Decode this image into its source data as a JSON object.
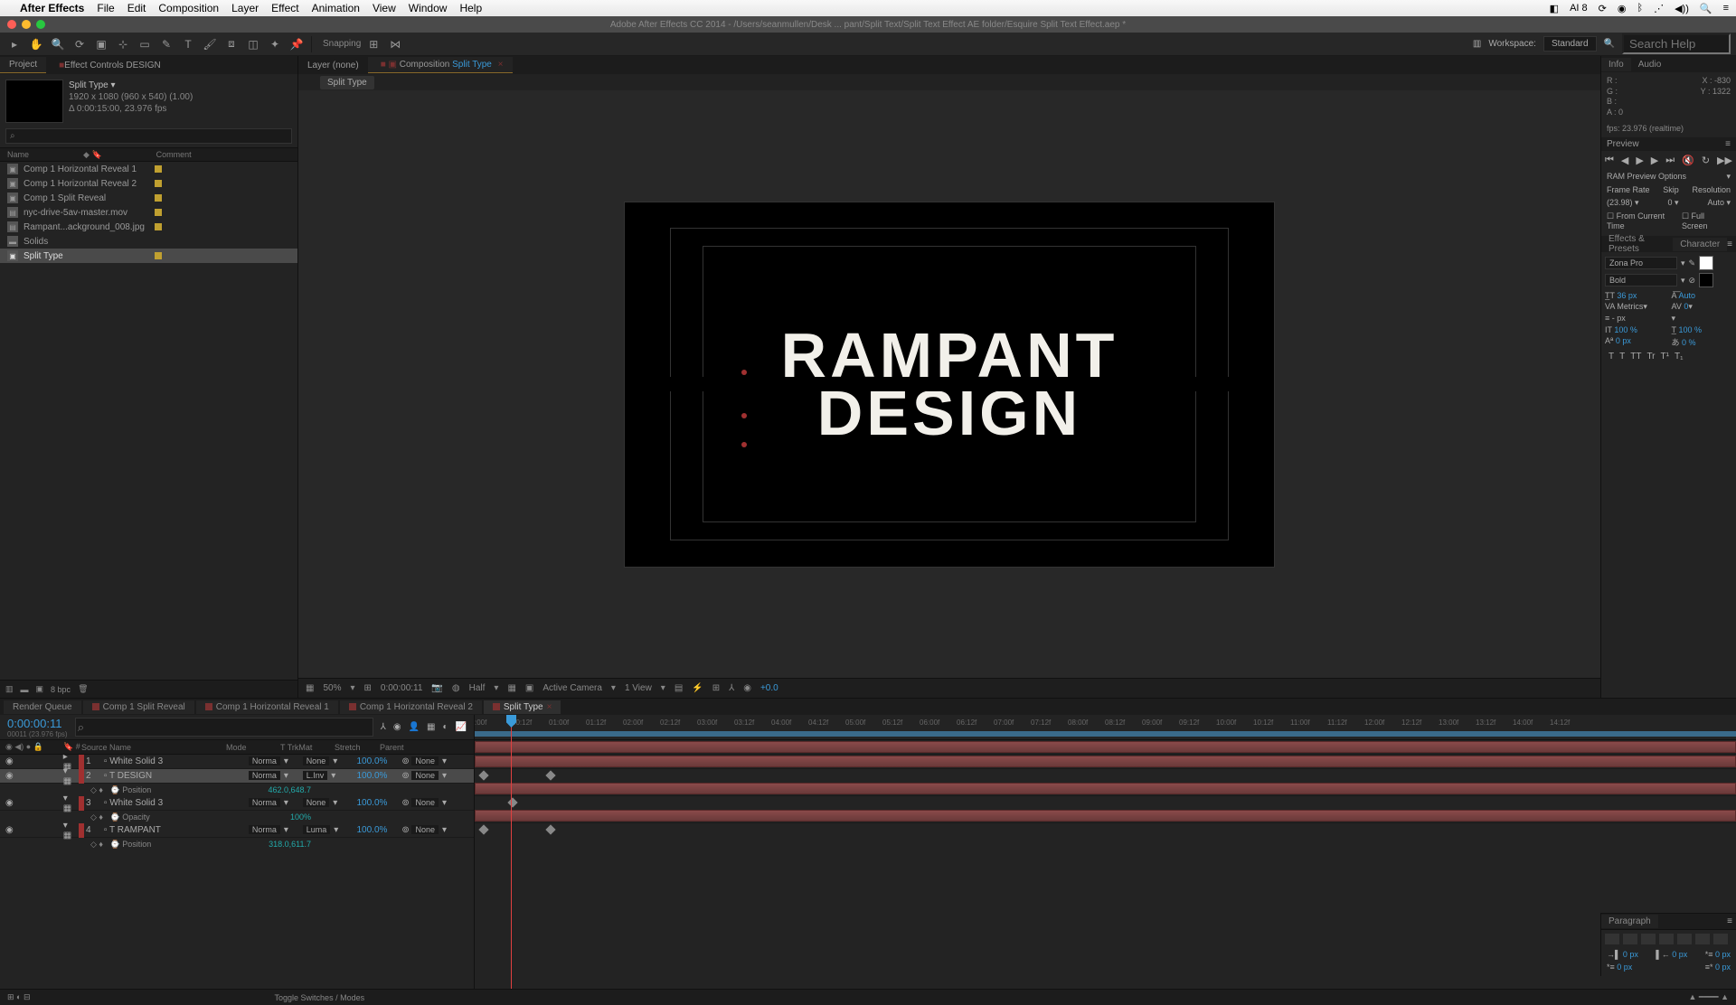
{
  "app": {
    "name": "After Effects",
    "menus": [
      "File",
      "Edit",
      "Composition",
      "Layer",
      "Effect",
      "Animation",
      "View",
      "Window",
      "Help"
    ],
    "window_title": "Adobe After Effects CC 2014 - /Users/seanmullen/Desk ... pant/Split Text/Split Text Effect AE folder/Esquire Split Text Effect.aep *"
  },
  "toolbar": {
    "snapping": "Snapping",
    "workspace_label": "Workspace:",
    "workspace_value": "Standard",
    "search_placeholder": "Search Help"
  },
  "project": {
    "tabs": {
      "project": "Project",
      "effect_controls": "Effect Controls DESIGN"
    },
    "selected_item": "Split Type ▾",
    "meta_line1": "1920 x 1080 (960 x 540) (1.00)",
    "meta_line2": "Δ 0:00:15:00, 23.976 fps",
    "header": {
      "name": "Name",
      "comment": "Comment"
    },
    "items": [
      {
        "name": "Comp 1 Horizontal Reveal 1",
        "type": "comp"
      },
      {
        "name": "Comp 1 Horizontal Reveal 2",
        "type": "comp"
      },
      {
        "name": "Comp 1 Split Reveal",
        "type": "comp"
      },
      {
        "name": "nyc-drive-5av-master.mov",
        "type": "footage"
      },
      {
        "name": "Rampant...ackground_008.jpg",
        "type": "footage"
      },
      {
        "name": "Solids",
        "type": "folder"
      },
      {
        "name": "Split Type",
        "type": "comp",
        "selected": true
      }
    ],
    "footer_bpc": "8 bpc"
  },
  "composition": {
    "layer_tab": "Layer (none)",
    "comp_tab_prefix": "Composition",
    "comp_tab_name": "Split Type",
    "flow_pill": "Split Type",
    "text_top": "RAMPANT",
    "text_bottom": "DESIGN"
  },
  "view_controls": {
    "zoom": "50%",
    "timecode": "0:00:00:11",
    "quality": "Half",
    "camera": "Active Camera",
    "views": "1 View",
    "exposure": "+0.0"
  },
  "info": {
    "tab_info": "Info",
    "tab_audio": "Audio",
    "r": "R :",
    "g": "G :",
    "b": "B :",
    "a": "A : 0",
    "x": "X : -830",
    "y": "Y : 1322",
    "fps": "fps: 23.976 (realtime)"
  },
  "preview": {
    "title": "Preview",
    "ram_options": "RAM Preview Options",
    "hdr": {
      "frame_rate": "Frame Rate",
      "skip": "Skip",
      "resolution": "Resolution"
    },
    "vals": {
      "frame_rate": "(23.98) ▾",
      "skip": "0 ▾",
      "resolution": "Auto ▾"
    },
    "from_current": "From Current Time",
    "full_screen": "Full Screen"
  },
  "effects_presets": {
    "title": "Effects & Presets"
  },
  "character": {
    "title": "Character",
    "font": "Zona Pro",
    "style": "Bold",
    "size": "36 px",
    "leading": "Auto",
    "kerning": "Metrics",
    "tracking": "0",
    "dash_px": "- px",
    "vscale": "100 %",
    "hscale": "100 %",
    "baseline": "0 px",
    "tsume": "0 %",
    "buttons": [
      "T",
      "T",
      "TT",
      "Tr",
      "T¹",
      "T₁"
    ]
  },
  "paragraph": {
    "title": "Paragraph",
    "indent": "0 px",
    "space": "0 px"
  },
  "timeline": {
    "tabs": [
      "Render Queue",
      "Comp 1 Split Reveal",
      "Comp 1 Horizontal Reveal 1",
      "Comp 1 Horizontal Reveal 2",
      "Split Type"
    ],
    "active_tab": 4,
    "timecode": "0:00:00:11",
    "timecode_sub": "00011 (23.976 fps)",
    "cols": {
      "num": "#",
      "source": "Source Name",
      "mode": "Mode",
      "trkmat": "TrkMat",
      "stretch": "Stretch",
      "parent": "Parent"
    },
    "ruler_ticks": [
      ":00f",
      "00:12f",
      "01:00f",
      "01:12f",
      "02:00f",
      "02:12f",
      "03:00f",
      "03:12f",
      "04:00f",
      "04:12f",
      "05:00f",
      "05:12f",
      "06:00f",
      "06:12f",
      "07:00f",
      "07:12f",
      "08:00f",
      "08:12f",
      "09:00f",
      "09:12f",
      "10:00f",
      "10:12f",
      "11:00f",
      "11:12f",
      "12:00f",
      "12:12f",
      "13:00f",
      "13:12f",
      "14:00f",
      "14:12f"
    ],
    "layers": [
      {
        "num": "1",
        "name": "White Solid 3",
        "mode": "Norma",
        "trkmat": "None",
        "stretch": "100.0%",
        "parent": "None"
      },
      {
        "num": "2",
        "name": "DESIGN",
        "mode": "Norma",
        "trkmat": "L.Inv",
        "stretch": "100.0%",
        "parent": "None",
        "selected": true,
        "prop": {
          "name": "Position",
          "value": "462.0,648.7"
        }
      },
      {
        "num": "3",
        "name": "White Solid 3",
        "mode": "Norma",
        "trkmat": "None",
        "stretch": "100.0%",
        "parent": "None",
        "prop": {
          "name": "Opacity",
          "value": "100%"
        }
      },
      {
        "num": "4",
        "name": "RAMPANT",
        "mode": "Norma",
        "trkmat": "Luma",
        "stretch": "100.0%",
        "parent": "None",
        "prop": {
          "name": "Position",
          "value": "318.0,611.7"
        }
      }
    ],
    "footer_toggle": "Toggle Switches / Modes"
  }
}
